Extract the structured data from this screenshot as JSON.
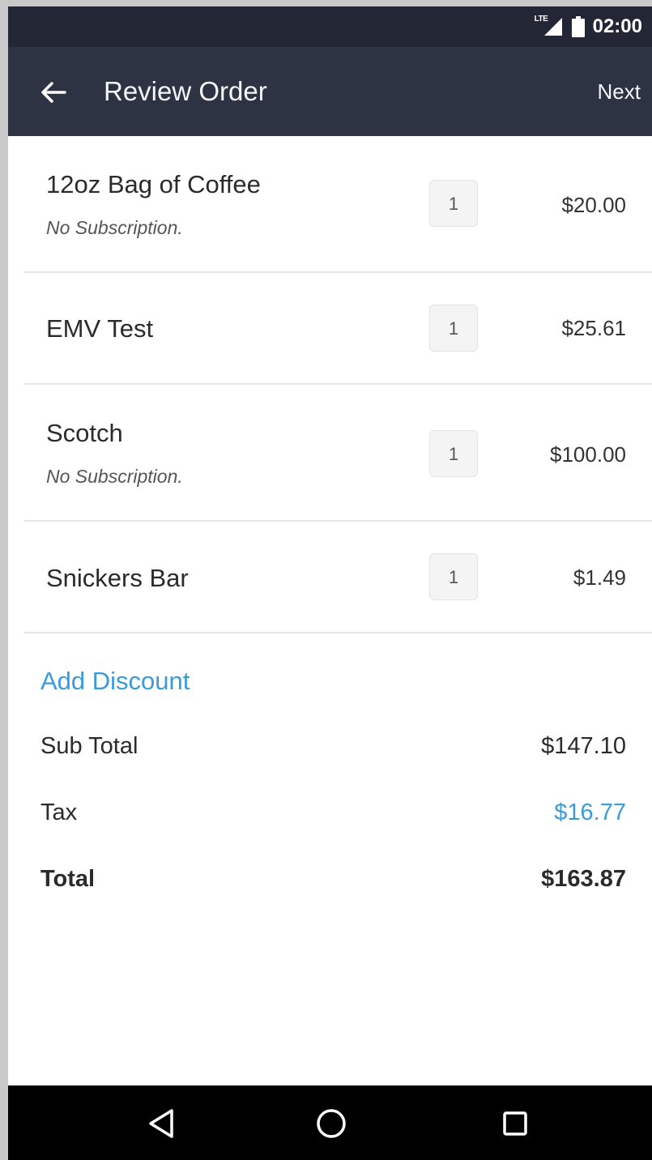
{
  "status_bar": {
    "network_label": "LTE",
    "time": "02:00"
  },
  "app_bar": {
    "title": "Review Order",
    "next_label": "Next",
    "back_icon": "arrow-left-icon"
  },
  "items": [
    {
      "name": "12oz Bag of Coffee",
      "subtitle": "No Subscription.",
      "qty": "1",
      "price": "$20.00"
    },
    {
      "name": "EMV Test",
      "subtitle": "",
      "qty": "1",
      "price": "$25.61"
    },
    {
      "name": "Scotch",
      "subtitle": "No Subscription.",
      "qty": "1",
      "price": "$100.00"
    },
    {
      "name": "Snickers Bar",
      "subtitle": "",
      "qty": "1",
      "price": "$1.49"
    }
  ],
  "add_discount_label": "Add Discount",
  "summary": {
    "subtotal_label": "Sub Total",
    "subtotal_value": "$147.10",
    "tax_label": "Tax",
    "tax_value": "$16.77",
    "total_label": "Total",
    "total_value": "$163.87"
  },
  "colors": {
    "accent": "#3b9bd9",
    "app_bar": "#2e3344",
    "status_bar": "#232735"
  }
}
